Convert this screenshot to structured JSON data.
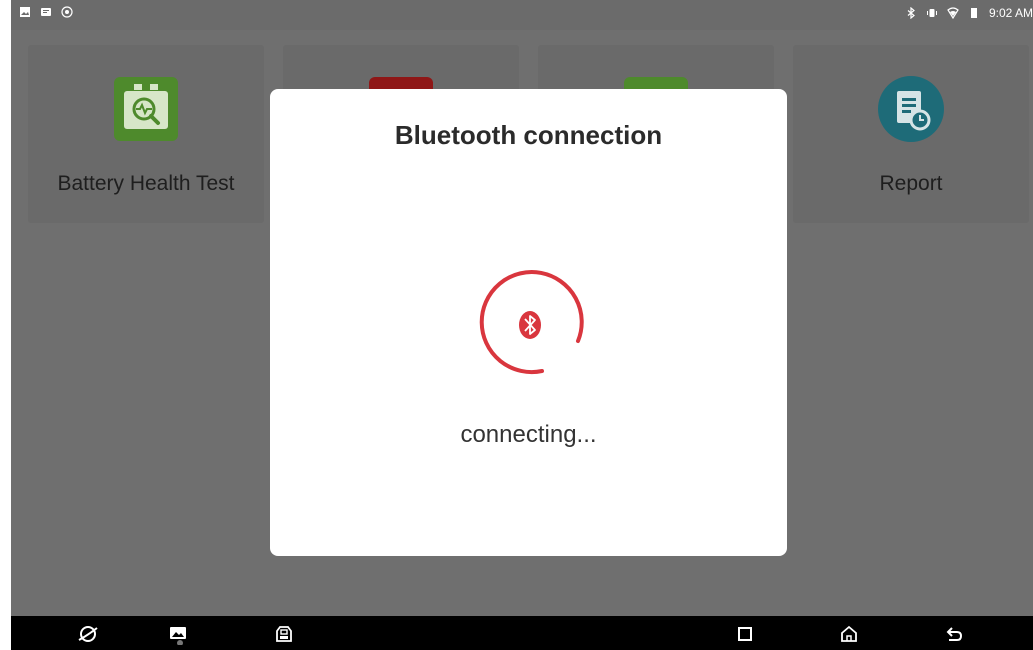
{
  "status_bar": {
    "left_icons": [
      "image-icon",
      "message-icon",
      "target-icon"
    ],
    "right_icons": [
      "bluetooth-icon",
      "vibrate-icon",
      "wifi-icon",
      "battery-icon"
    ],
    "time": "9:02 AM"
  },
  "tiles": [
    {
      "label": "Battery Health Test",
      "icon": "battery-test-icon",
      "color": "#4e8a2c"
    },
    {
      "label": "",
      "icon": "red-app-icon",
      "color": "#8f1717"
    },
    {
      "label": "",
      "icon": "green-app-icon",
      "color": "#4e8a2c"
    },
    {
      "label": "Report",
      "icon": "report-icon",
      "color": "#1e6b78"
    }
  ],
  "dialog": {
    "title": "Bluetooth connection",
    "status": "connecting...",
    "icon": "bluetooth-icon",
    "accent": "#d9363e"
  },
  "nav_bar": {
    "buttons": [
      "browser-icon",
      "gallery-icon",
      "vci-icon",
      "recents-icon",
      "home-icon",
      "back-icon"
    ]
  },
  "colors": {
    "overlay": "#6f6f6f",
    "status_bar": "#6b6b6b",
    "nav_bar": "#000000"
  }
}
